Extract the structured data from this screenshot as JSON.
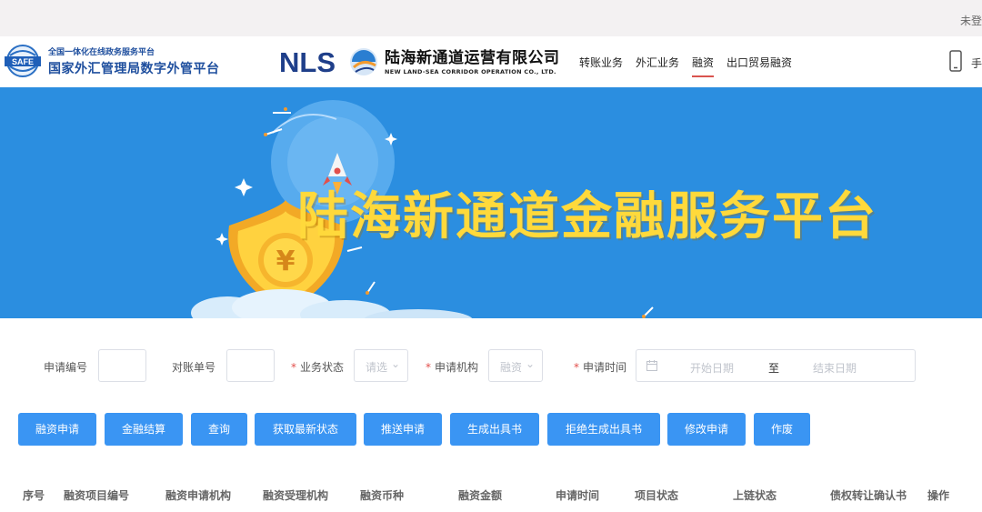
{
  "topbar": {
    "login_text": "未登"
  },
  "header": {
    "safe_logo_text": "SAFE",
    "safe_subtitle": "全国一体化在线政务服务平台",
    "safe_title": "国家外汇管理局数字外管平台",
    "nls_logo_text": "NLS",
    "nls_name": "陆海新通道运营有限公司",
    "nls_en": "NEW LAND-SEA CORRIDOR OPERATION CO., LTD.",
    "nav": [
      {
        "label": "转账业务",
        "active": false
      },
      {
        "label": "外汇业务",
        "active": false
      },
      {
        "label": "融资",
        "active": true
      },
      {
        "label": "出口贸易融资",
        "active": false
      }
    ],
    "phone_text": "手"
  },
  "banner": {
    "title": "陆海新通道金融服务平台",
    "coin_symbol": "¥"
  },
  "filters": {
    "apply_no_label": "申请编号",
    "apply_no_value": "",
    "check_no_label": "对账单号",
    "check_no_value": "",
    "status_label": "业务状态",
    "status_placeholder": "请选",
    "org_label": "申请机构",
    "org_placeholder": "融资",
    "time_label": "申请时间",
    "start_placeholder": "开始日期",
    "range_separator": "至",
    "end_placeholder": "结束日期"
  },
  "buttons": [
    "融资申请",
    "金融结算",
    "查询",
    "获取最新状态",
    "推送申请",
    "生成出具书",
    "拒绝生成出具书",
    "修改申请",
    "作废"
  ],
  "table": {
    "columns": [
      "序号",
      "融资项目编号",
      "融资申请机构",
      "融资受理机构",
      "融资币种",
      "融资金额",
      "申请时间",
      "项目状态",
      "上链状态",
      "债权转让确认书",
      "操作"
    ]
  },
  "colors": {
    "primary": "#3a95f3",
    "banner": "#2b8ee0",
    "title_yellow": "#ffd93b",
    "required_star": "#e2504c",
    "nav_active": "#d9534f",
    "safe_blue": "#1f4f9e"
  }
}
